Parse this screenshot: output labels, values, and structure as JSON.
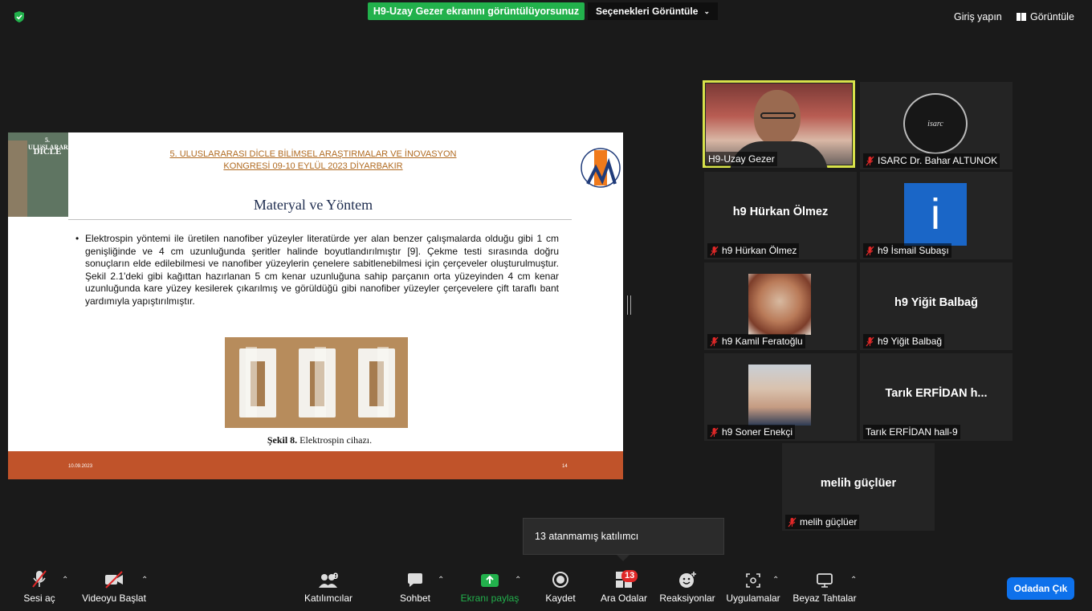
{
  "topbar": {
    "share_banner": "H9-Uzay Gezer ekranını görüntülüyorsunuz",
    "view_options": "Seçenekleri Görüntüle",
    "sign_in": "Giriş yapın",
    "view": "Görüntüle"
  },
  "slide": {
    "poster_line1": "5. ULUSLARARASI",
    "poster_line2": "DİCLE",
    "congress_title": "5. ULUSLARARASI DİCLE BİLİMSEL ARAŞTIRMALAR VE İNOVASYON KONGRESİ 09-10 EYLÜL 2023 DİYARBAKIR",
    "title": "Materyal ve Yöntem",
    "body": "Elektrospin yöntemi ile üretilen nanofiber yüzeyler literatürde yer alan benzer çalışmalarda olduğu gibi 1 cm genişliğinde ve 4 cm uzunluğunda şeritler halinde boyutlandırılmıştır [9]. Çekme testi sırasında doğru sonuçların elde edilebilmesi ve nanofiber yüzeylerin çenelere sabitlenebilmesi için çerçeveler oluşturulmuştur. Şekil 2.1'deki gibi kağıttan hazırlanan 5 cm kenar uzunluğuna sahip parçanın orta yüzeyinden 4 cm kenar uzunluğunda kare yüzey kesilerek çıkarılmış ve görüldüğü gibi nanofiber yüzeyler çerçevelere çift taraflı bant yardımıyla yapıştırılmıştır.",
    "caption_bold": "Şekil 8.",
    "caption_text": " Elektrospin cihazı.",
    "footer_date": "10.09.2023",
    "footer_page": "14"
  },
  "participants": [
    {
      "name": "H9-Uzay Gezer",
      "muted": false,
      "active": true
    },
    {
      "name": "ISARC Dr. Bahar ALTUNOK",
      "muted": true
    },
    {
      "name": "h9 Hürkan Ölmez",
      "display": "h9 Hürkan Ölmez",
      "muted": true
    },
    {
      "name": "h9 İsmail Subaşı",
      "avatar_letter": "i",
      "muted": true
    },
    {
      "name": "h9 Kamil Feratoğlu",
      "muted": true
    },
    {
      "name": "h9 Yiğit Balbağ",
      "display": "h9 Yiğit Balbağ",
      "muted": true
    },
    {
      "name": "h9 Soner Enekçi",
      "muted": true
    },
    {
      "name": "Tarık ERFİDAN hall-9",
      "display": "Tarık ERFİDAN h...",
      "muted": false
    },
    {
      "name": "melih güçlüer",
      "display": "melih güçlüer",
      "muted": true
    }
  ],
  "isarc_logo_text": "isarc",
  "tooltip": "13 atanmamış katılımcı",
  "toolbar": {
    "audio": "Sesi aç",
    "video": "Videoyu Başlat",
    "participants": "Katılımcılar",
    "participants_count": "9",
    "chat": "Sohbet",
    "share": "Ekranı paylaş",
    "record": "Kaydet",
    "breakout": "Ara Odalar",
    "breakout_badge": "13",
    "reactions": "Reaksiyonlar",
    "apps": "Uygulamalar",
    "whiteboard": "Beyaz Tahtalar",
    "leave": "Odadan Çık"
  },
  "colors": {
    "share_green": "#22b14c",
    "active_border": "#d8e24a",
    "leave_blue": "#0e71eb",
    "mute_red": "#e02828",
    "slide_footer": "#c0532a"
  }
}
